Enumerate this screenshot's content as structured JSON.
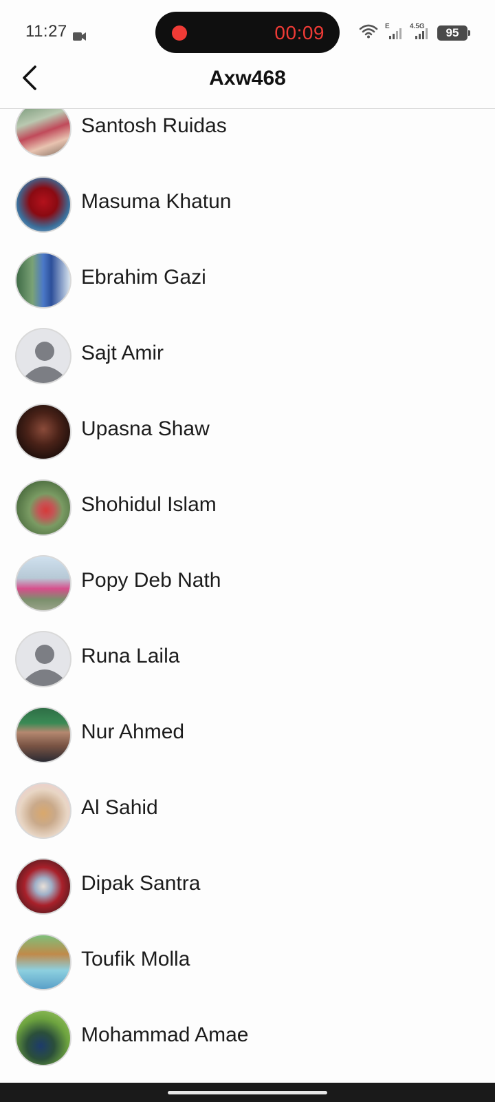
{
  "status_bar": {
    "time": "11:27",
    "recording_timer": "00:09",
    "signal_label_1": "E",
    "signal_label_2": "4.5G",
    "battery_level": "95"
  },
  "header": {
    "title": "Axw468"
  },
  "contacts": [
    {
      "name": "Santosh Ruidas",
      "avatar": "photo"
    },
    {
      "name": "Masuma Khatun",
      "avatar": "photo"
    },
    {
      "name": "Ebrahim Gazi",
      "avatar": "photo"
    },
    {
      "name": "Sajt Amir",
      "avatar": "default"
    },
    {
      "name": "Upasna Shaw",
      "avatar": "photo"
    },
    {
      "name": "Shohidul Islam",
      "avatar": "photo"
    },
    {
      "name": "Popy Deb Nath",
      "avatar": "photo"
    },
    {
      "name": "Runa Laila",
      "avatar": "default"
    },
    {
      "name": "Nur Ahmed",
      "avatar": "photo"
    },
    {
      "name": "Al Sahid",
      "avatar": "photo"
    },
    {
      "name": "Dipak Santra",
      "avatar": "photo"
    },
    {
      "name": "Toufik Molla",
      "avatar": "photo"
    },
    {
      "name": "Mohammad Amae",
      "avatar": "photo"
    }
  ],
  "colors": {
    "recording_red": "#ef3b36",
    "background": "#fdfdfd",
    "text": "#1c1c1c"
  }
}
